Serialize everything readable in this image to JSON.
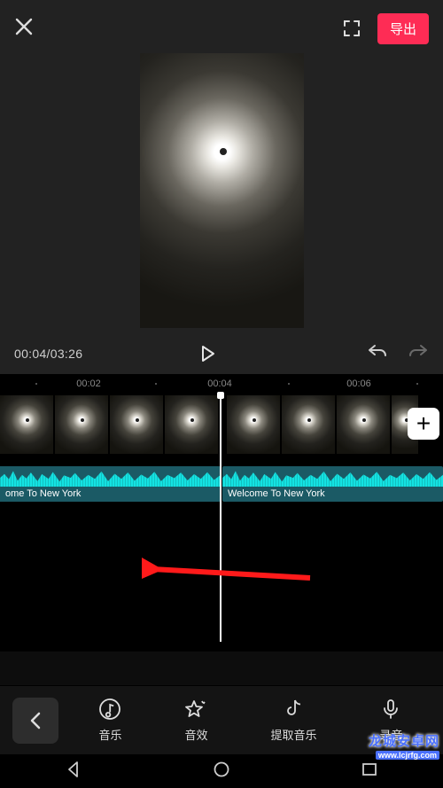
{
  "header": {
    "export_label": "导出"
  },
  "player": {
    "current_time": "00:04",
    "total_time": "03:26"
  },
  "ruler": {
    "marks": [
      "00:02",
      "00:04",
      "00:06"
    ]
  },
  "audio": {
    "left_label": "ome To New York",
    "right_label": "Welcome To New York"
  },
  "tools": {
    "items": [
      {
        "id": "music",
        "label": "音乐"
      },
      {
        "id": "sfx",
        "label": "音效"
      },
      {
        "id": "extract",
        "label": "提取音乐"
      },
      {
        "id": "record",
        "label": "录音"
      }
    ]
  },
  "watermark": {
    "line1": "龙城安卓网",
    "line2": "www.lcjrfg.com"
  },
  "colors": {
    "accent": "#fe2c55",
    "wave": "#14e2e2"
  }
}
